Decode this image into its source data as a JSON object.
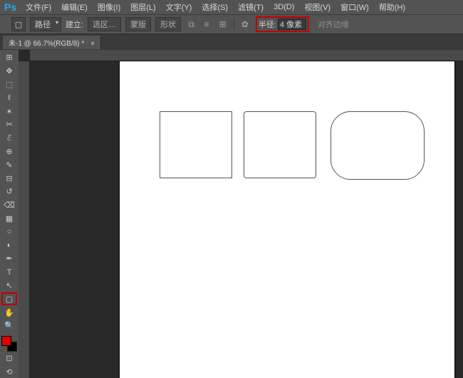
{
  "app": {
    "logo": "Ps"
  },
  "menu": {
    "file": "文件(F)",
    "edit": "编辑(E)",
    "image": "图像(I)",
    "layer": "图层(L)",
    "type": "文字(Y)",
    "select": "选择(S)",
    "filter": "滤镜(T)",
    "threeD": "3D(D)",
    "view": "视图(V)",
    "window": "窗口(W)",
    "help": "帮助(H)"
  },
  "options": {
    "mode": "路径",
    "make": "建立:",
    "selection": "选区…",
    "mask": "蒙版",
    "shape": "形状",
    "radius_label": "半径:",
    "radius_value": "4 像素",
    "align_edges": "对齐边缘"
  },
  "doc": {
    "title": "未-1 @ 66.7%(RGB/8) *",
    "close": "×"
  },
  "tools": {
    "grab": "⊞",
    "move": "✥",
    "marquee": "⬚",
    "lasso": "ℓ",
    "wand": "✶",
    "crop": "✂",
    "eyedrop": "ℰ",
    "heal": "⊕",
    "brush": "✎",
    "stamp": "⊟",
    "history": "↺",
    "eraser": "⌫",
    "gradient": "▦",
    "blur": "○",
    "dodge": "◐",
    "pen": "✒",
    "type": "T",
    "path": "↖",
    "rect": "▢",
    "hand": "✋",
    "zoom": "🔍",
    "extra1": "⊡",
    "extra2": "⟲"
  },
  "icons": {
    "rounded_rect": "▢",
    "boolean": "⧉",
    "align": "≡",
    "arrange": "⊞",
    "gear": "✿"
  }
}
